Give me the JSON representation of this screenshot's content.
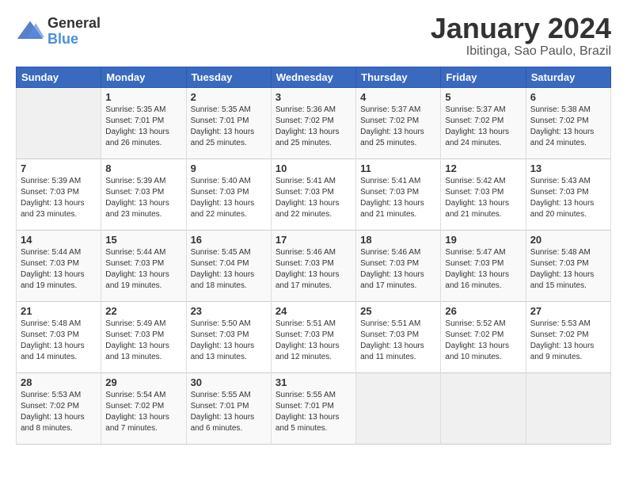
{
  "header": {
    "logo_general": "General",
    "logo_blue": "Blue",
    "month_title": "January 2024",
    "subtitle": "Ibitinga, Sao Paulo, Brazil"
  },
  "days_of_week": [
    "Sunday",
    "Monday",
    "Tuesday",
    "Wednesday",
    "Thursday",
    "Friday",
    "Saturday"
  ],
  "weeks": [
    [
      {
        "day": "",
        "info": ""
      },
      {
        "day": "1",
        "info": "Sunrise: 5:35 AM\nSunset: 7:01 PM\nDaylight: 13 hours\nand 26 minutes."
      },
      {
        "day": "2",
        "info": "Sunrise: 5:35 AM\nSunset: 7:01 PM\nDaylight: 13 hours\nand 25 minutes."
      },
      {
        "day": "3",
        "info": "Sunrise: 5:36 AM\nSunset: 7:02 PM\nDaylight: 13 hours\nand 25 minutes."
      },
      {
        "day": "4",
        "info": "Sunrise: 5:37 AM\nSunset: 7:02 PM\nDaylight: 13 hours\nand 25 minutes."
      },
      {
        "day": "5",
        "info": "Sunrise: 5:37 AM\nSunset: 7:02 PM\nDaylight: 13 hours\nand 24 minutes."
      },
      {
        "day": "6",
        "info": "Sunrise: 5:38 AM\nSunset: 7:02 PM\nDaylight: 13 hours\nand 24 minutes."
      }
    ],
    [
      {
        "day": "7",
        "info": "Sunrise: 5:39 AM\nSunset: 7:03 PM\nDaylight: 13 hours\nand 23 minutes."
      },
      {
        "day": "8",
        "info": "Sunrise: 5:39 AM\nSunset: 7:03 PM\nDaylight: 13 hours\nand 23 minutes."
      },
      {
        "day": "9",
        "info": "Sunrise: 5:40 AM\nSunset: 7:03 PM\nDaylight: 13 hours\nand 22 minutes."
      },
      {
        "day": "10",
        "info": "Sunrise: 5:41 AM\nSunset: 7:03 PM\nDaylight: 13 hours\nand 22 minutes."
      },
      {
        "day": "11",
        "info": "Sunrise: 5:41 AM\nSunset: 7:03 PM\nDaylight: 13 hours\nand 21 minutes."
      },
      {
        "day": "12",
        "info": "Sunrise: 5:42 AM\nSunset: 7:03 PM\nDaylight: 13 hours\nand 21 minutes."
      },
      {
        "day": "13",
        "info": "Sunrise: 5:43 AM\nSunset: 7:03 PM\nDaylight: 13 hours\nand 20 minutes."
      }
    ],
    [
      {
        "day": "14",
        "info": "Sunrise: 5:44 AM\nSunset: 7:03 PM\nDaylight: 13 hours\nand 19 minutes."
      },
      {
        "day": "15",
        "info": "Sunrise: 5:44 AM\nSunset: 7:03 PM\nDaylight: 13 hours\nand 19 minutes."
      },
      {
        "day": "16",
        "info": "Sunrise: 5:45 AM\nSunset: 7:04 PM\nDaylight: 13 hours\nand 18 minutes."
      },
      {
        "day": "17",
        "info": "Sunrise: 5:46 AM\nSunset: 7:03 PM\nDaylight: 13 hours\nand 17 minutes."
      },
      {
        "day": "18",
        "info": "Sunrise: 5:46 AM\nSunset: 7:03 PM\nDaylight: 13 hours\nand 17 minutes."
      },
      {
        "day": "19",
        "info": "Sunrise: 5:47 AM\nSunset: 7:03 PM\nDaylight: 13 hours\nand 16 minutes."
      },
      {
        "day": "20",
        "info": "Sunrise: 5:48 AM\nSunset: 7:03 PM\nDaylight: 13 hours\nand 15 minutes."
      }
    ],
    [
      {
        "day": "21",
        "info": "Sunrise: 5:48 AM\nSunset: 7:03 PM\nDaylight: 13 hours\nand 14 minutes."
      },
      {
        "day": "22",
        "info": "Sunrise: 5:49 AM\nSunset: 7:03 PM\nDaylight: 13 hours\nand 13 minutes."
      },
      {
        "day": "23",
        "info": "Sunrise: 5:50 AM\nSunset: 7:03 PM\nDaylight: 13 hours\nand 13 minutes."
      },
      {
        "day": "24",
        "info": "Sunrise: 5:51 AM\nSunset: 7:03 PM\nDaylight: 13 hours\nand 12 minutes."
      },
      {
        "day": "25",
        "info": "Sunrise: 5:51 AM\nSunset: 7:03 PM\nDaylight: 13 hours\nand 11 minutes."
      },
      {
        "day": "26",
        "info": "Sunrise: 5:52 AM\nSunset: 7:02 PM\nDaylight: 13 hours\nand 10 minutes."
      },
      {
        "day": "27",
        "info": "Sunrise: 5:53 AM\nSunset: 7:02 PM\nDaylight: 13 hours\nand 9 minutes."
      }
    ],
    [
      {
        "day": "28",
        "info": "Sunrise: 5:53 AM\nSunset: 7:02 PM\nDaylight: 13 hours\nand 8 minutes."
      },
      {
        "day": "29",
        "info": "Sunrise: 5:54 AM\nSunset: 7:02 PM\nDaylight: 13 hours\nand 7 minutes."
      },
      {
        "day": "30",
        "info": "Sunrise: 5:55 AM\nSunset: 7:01 PM\nDaylight: 13 hours\nand 6 minutes."
      },
      {
        "day": "31",
        "info": "Sunrise: 5:55 AM\nSunset: 7:01 PM\nDaylight: 13 hours\nand 5 minutes."
      },
      {
        "day": "",
        "info": ""
      },
      {
        "day": "",
        "info": ""
      },
      {
        "day": "",
        "info": ""
      }
    ]
  ]
}
